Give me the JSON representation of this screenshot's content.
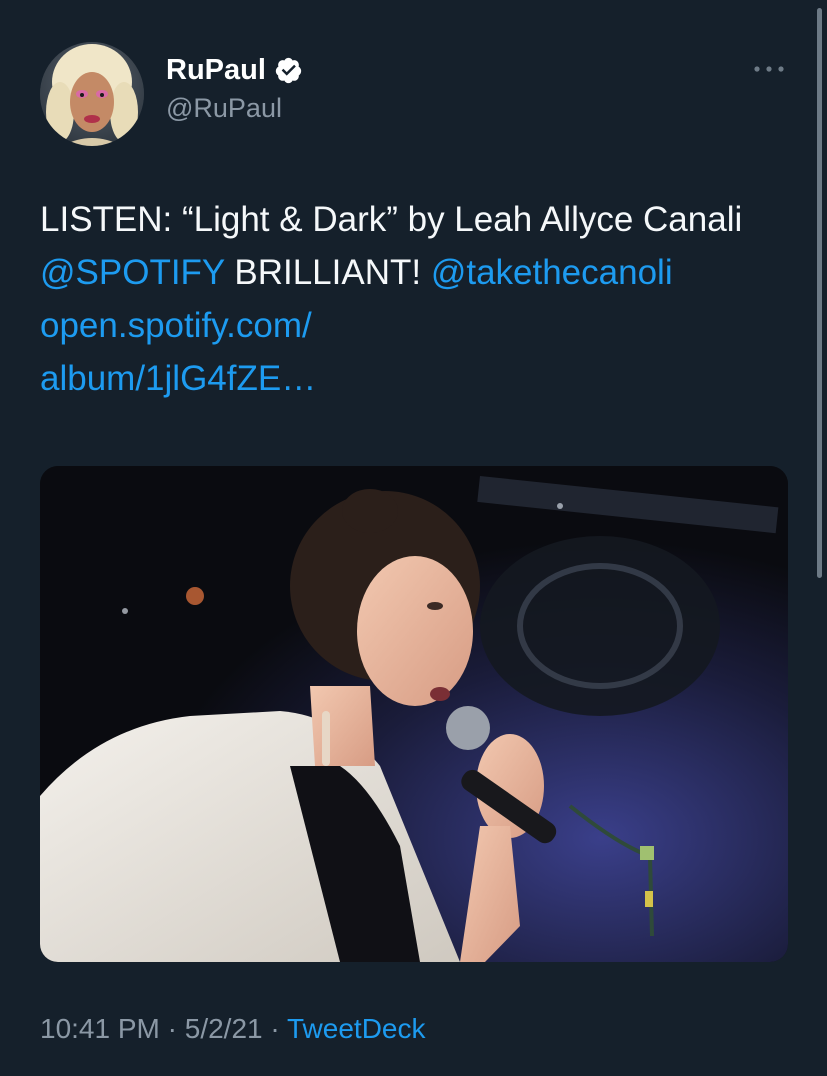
{
  "tweet": {
    "author": {
      "display_name": "RuPaul",
      "handle": "@RuPaul",
      "verified": true
    },
    "text": {
      "part1": "LISTEN: “Light & Dark” by Leah Allyce Canali ",
      "mention_spotify": "@SPOTIFY",
      "part2": " BRILLIANT! ",
      "mention_user": "@takethecanoli",
      "space": " ",
      "link": "open.spotify.com/\nalbum/1jlG4fZE…"
    },
    "time": "10:41 PM",
    "separator": " · ",
    "date": "5/2/21",
    "source": "TweetDeck"
  },
  "icons": {
    "more": "more-horizontal-icon",
    "verified": "verified-badge-icon"
  },
  "colors": {
    "background": "#15202b",
    "text": "#f5f8fa",
    "secondary": "#8b98a5",
    "accent": "#1d9bf0"
  }
}
